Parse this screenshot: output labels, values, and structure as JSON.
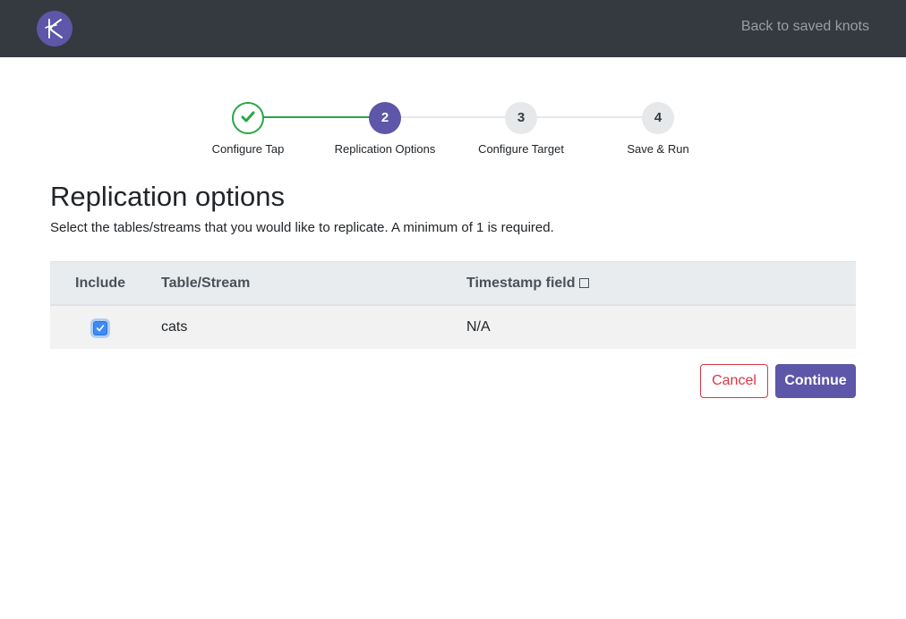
{
  "navbar": {
    "logo_icon": "knot-logo-icon",
    "back_link": "Back to saved knots"
  },
  "stepper": {
    "steps": [
      {
        "number": "",
        "label": "Configure Tap",
        "state": "complete"
      },
      {
        "number": "2",
        "label": "Replication Options",
        "state": "active"
      },
      {
        "number": "3",
        "label": "Configure Target",
        "state": "pending"
      },
      {
        "number": "4",
        "label": "Save & Run",
        "state": "pending"
      }
    ]
  },
  "page": {
    "title": "Replication options",
    "description": "Select the tables/streams that you would like to replicate. A minimum of 1 is required."
  },
  "table": {
    "headers": [
      "Include",
      "Table/Stream",
      "Timestamp field"
    ],
    "rows": [
      {
        "include": true,
        "stream": "cats",
        "timestamp": "N/A"
      }
    ]
  },
  "actions": {
    "cancel": "Cancel",
    "continue": "Continue"
  },
  "colors": {
    "navbar": "#343a40",
    "brand": "#5e56a8",
    "success": "#28a745",
    "danger": "#dc3545",
    "checkbox": "#3d8bf7"
  }
}
